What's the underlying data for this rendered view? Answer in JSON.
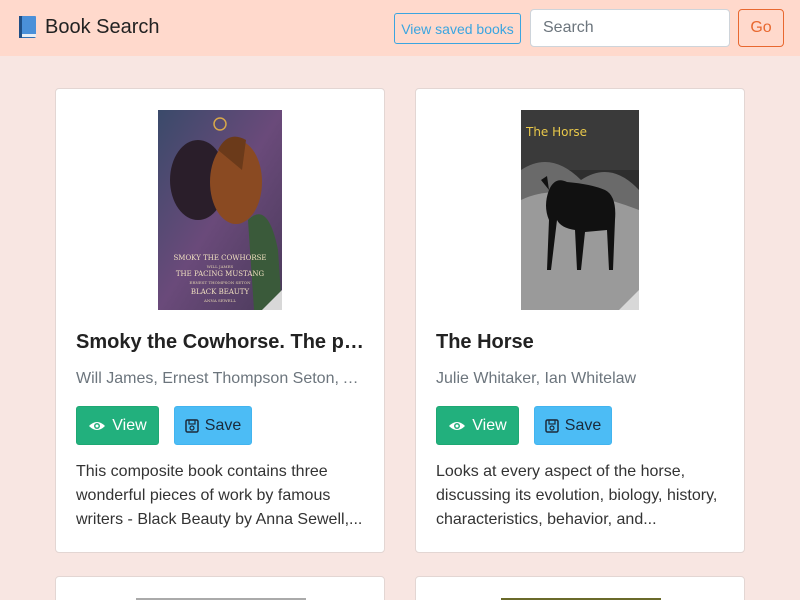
{
  "header": {
    "brand_label": "Book Search",
    "saved_books_label": "View saved books",
    "search_placeholder": "Search",
    "go_label": "Go"
  },
  "books": [
    {
      "title": "Smoky the Cowhorse. The pa...",
      "authors": "Will James, Ernest Thompson Seton, A...",
      "view_label": "View",
      "save_label": "Save",
      "description": [
        "This composite book contains three",
        "wonderful pieces of work by famous",
        "writers - Black Beauty by Anna Sewell,..."
      ],
      "cover_text": [
        "SMOKY THE COWHORSE",
        "WILL JAMES",
        "THE PACING MUSTANG",
        "ERNEST THOMPSON SETON",
        "BLACK BEAUTY",
        "ANNA SEWELL"
      ]
    },
    {
      "title": "The Horse",
      "authors": "Julie Whitaker, Ian Whitelaw",
      "view_label": "View",
      "save_label": "Save",
      "description": [
        "Looks at every aspect of the horse,",
        "discussing its evolution, biology, history,",
        "characteristics, behavior, and..."
      ],
      "cover_text": [
        "The Horse"
      ]
    }
  ],
  "icons": {
    "brand": "blue-book-icon",
    "view": "eye-icon",
    "save": "floppy-disk-icon"
  },
  "colors": {
    "navbar_bg": "#ffd9cc",
    "page_bg": "#f8e6e2",
    "view_button": "#22b07d",
    "save_button": "#4cbcf5",
    "go_button": "#e8682f",
    "saved_books_button": "#3aa5e0"
  }
}
